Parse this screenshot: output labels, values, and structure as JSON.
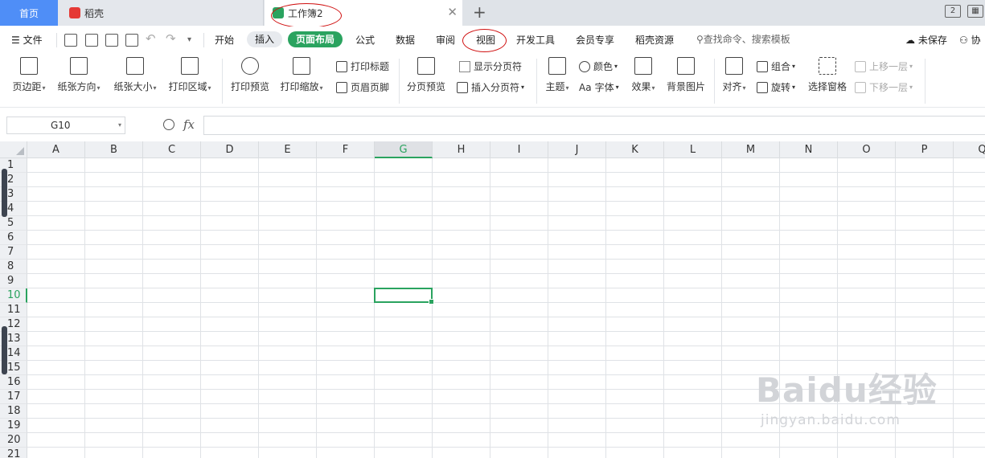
{
  "tabs": {
    "home": "首页",
    "docer": "稻壳",
    "workbook": "工作簿2"
  },
  "menu": {
    "file": "文件",
    "items": [
      "开始",
      "插入",
      "页面布局",
      "公式",
      "数据",
      "审阅",
      "视图",
      "开发工具",
      "会员专享",
      "稻壳资源"
    ],
    "search": "查找命令、搜索模板",
    "unsaved": "未保存",
    "collab": "协"
  },
  "ribbon": {
    "margins": "页边距",
    "orientation": "纸张方向",
    "size": "纸张大小",
    "print_area": "打印区域",
    "print_preview": "打印预览",
    "print_scale": "打印缩放",
    "print_titles": "打印标题",
    "header_footer": "页眉页脚",
    "page_break_preview": "分页预览",
    "show_page_breaks": "显示分页符",
    "insert_page_break": "插入分页符",
    "theme": "主题",
    "colors": "颜色",
    "fonts": "字体",
    "fonts_prefix": "Aa",
    "effects": "效果",
    "background": "背景图片",
    "align": "对齐",
    "group": "组合",
    "rotate": "旋转",
    "selection_pane": "选择窗格",
    "bring_forward": "上移一层",
    "send_backward": "下移一层"
  },
  "formula_bar": {
    "name_box": "G10",
    "fx": "fx",
    "formula": ""
  },
  "sheet": {
    "columns": [
      "A",
      "B",
      "C",
      "D",
      "E",
      "F",
      "G",
      "H",
      "I",
      "J",
      "K",
      "L",
      "M",
      "N",
      "O",
      "P",
      "Q"
    ],
    "rows": [
      "1",
      "2",
      "3",
      "4",
      "5",
      "6",
      "7",
      "8",
      "9",
      "10",
      "11",
      "12",
      "13",
      "14",
      "15",
      "16",
      "17",
      "18",
      "19",
      "20",
      "21"
    ],
    "selected_column": "G",
    "selected_row": "10"
  },
  "colors": {
    "accent_green": "#2aa35f",
    "home_tab_blue": "#4f8ef7",
    "annotation_red": "#d01010"
  },
  "watermark": {
    "brand": "Baidu经验",
    "url": "jingyan.baidu.com"
  }
}
